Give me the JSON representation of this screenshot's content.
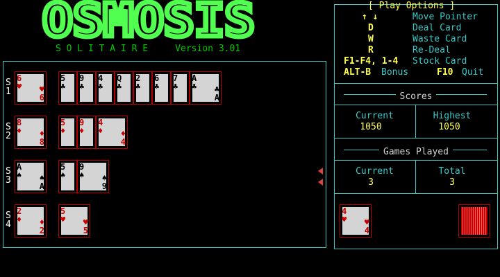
{
  "title": {
    "logo": "OSMOSIS",
    "subtitle": "S O L I T A I R E",
    "version": "Version 3.01"
  },
  "board": {
    "stacks": [
      {
        "label": [
          "S",
          "1"
        ],
        "foundation": {
          "rank": "6",
          "suit": "♥",
          "color": "red"
        },
        "tableau": [
          {
            "rank": "5",
            "suit": "♣",
            "color": "blk"
          },
          {
            "rank": "9",
            "suit": "♣",
            "color": "blk"
          },
          {
            "rank": "4",
            "suit": "♣",
            "color": "blk"
          },
          {
            "rank": "Q",
            "suit": "♣",
            "color": "blk"
          },
          {
            "rank": "2",
            "suit": "♣",
            "color": "blk"
          },
          {
            "rank": "6",
            "suit": "♣",
            "color": "blk"
          },
          {
            "rank": "7",
            "suit": "♣",
            "color": "blk"
          },
          {
            "rank": "A",
            "suit": "♣",
            "color": "blk"
          }
        ]
      },
      {
        "label": [
          "S",
          "2"
        ],
        "foundation": {
          "rank": "8",
          "suit": "♦",
          "color": "red"
        },
        "tableau": [
          {
            "rank": "5",
            "suit": "♦",
            "color": "red"
          },
          {
            "rank": "9",
            "suit": "♦",
            "color": "red"
          },
          {
            "rank": "4",
            "suit": "♦",
            "color": "red"
          }
        ]
      },
      {
        "label": [
          "S",
          "3"
        ],
        "foundation": {
          "rank": "A",
          "suit": "♠",
          "color": "blk"
        },
        "tableau": [
          {
            "rank": "5",
            "suit": "♠",
            "color": "blk"
          },
          {
            "rank": "9",
            "suit": "♠",
            "color": "blk"
          }
        ]
      },
      {
        "label": [
          "S",
          "4"
        ],
        "foundation": {
          "rank": "2",
          "suit": "♦",
          "color": "red"
        },
        "tableau": [
          {
            "rank": "5",
            "suit": "♥",
            "color": "red"
          }
        ]
      }
    ]
  },
  "options": {
    "header": "[ Play Options ]",
    "items": [
      {
        "key": "↑ ↓",
        "label": "Move Pointer"
      },
      {
        "key": "D",
        "label": "Deal Card"
      },
      {
        "key": "W",
        "label": "Waste Card"
      },
      {
        "key": "R",
        "label": "Re-Deal"
      },
      {
        "key": "F1-F4, 1-4",
        "label": "Stock Card"
      }
    ],
    "bonus_key": "ALT-B",
    "bonus_label": "Bonus",
    "quit_key": "F10",
    "quit_label": "Quit"
  },
  "scores": {
    "title": "Scores",
    "current_label": "Current",
    "current": "1050",
    "highest_label": "Highest",
    "highest": "1050"
  },
  "games": {
    "title": "Games Played",
    "current_label": "Current",
    "current": "3",
    "total_label": "Total",
    "total": "3"
  },
  "waste": {
    "rank": "4",
    "suit": "♥",
    "color": "red"
  },
  "colors": {
    "accent": "#3cc8c8",
    "title_green": "#50ff50",
    "highlight": "#ffff54",
    "card_red": "#c80000"
  }
}
